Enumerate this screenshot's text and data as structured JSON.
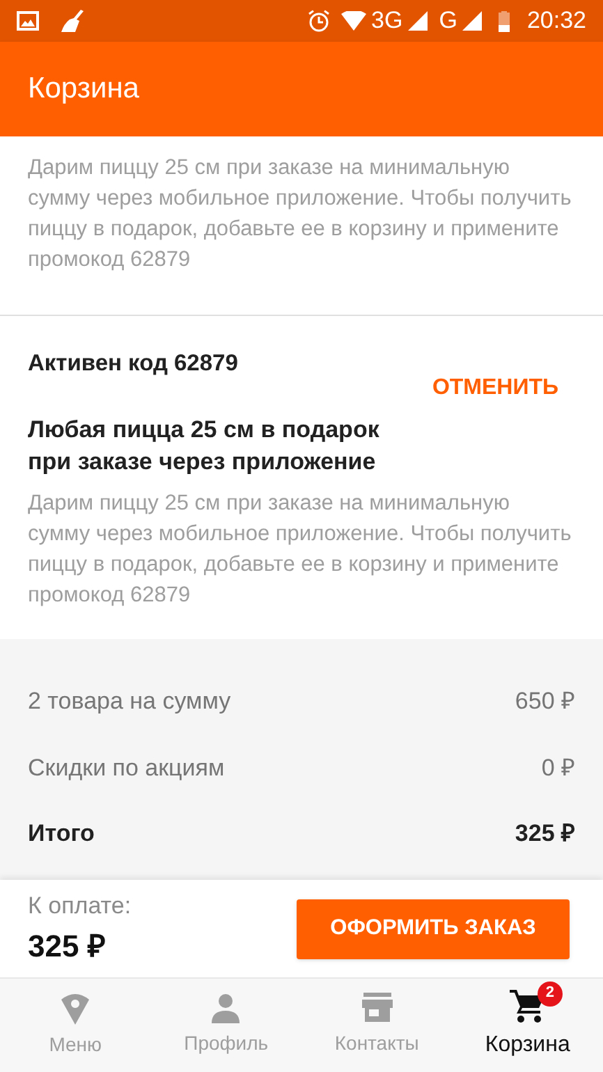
{
  "status_bar": {
    "network_1": "3G",
    "network_2": "G",
    "time": "20:32"
  },
  "app_bar": {
    "title": "Корзина"
  },
  "promo_description": "Дарим пиццу 25 см при заказе на минимальную сумму через мобильное приложение. Чтобы получить пиццу в подарок, добавьте ее в корзину и примените промокод 62879",
  "active_promo": {
    "code_label": "Активен код 62879",
    "cancel_button": "ОТМЕНИТЬ",
    "title": "Любая пицца 25 см в подарок при заказе через приложение",
    "description": "Дарим пиццу 25 см при заказе на минимальную сумму через мобильное приложение. Чтобы получить пиццу в подарок, добавьте ее в корзину и примените промокод 62879"
  },
  "summary": [
    {
      "label": "2 товара на сумму",
      "value": "650 ₽",
      "kind": "normal"
    },
    {
      "label": "Скидки по акциям",
      "value": "0 ₽",
      "kind": "normal"
    },
    {
      "label": "Итого",
      "value": "325 ₽",
      "kind": "total"
    }
  ],
  "checkout": {
    "label": "К оплате:",
    "amount": "325 ₽",
    "button": "ОФОРМИТЬ ЗАКАЗ"
  },
  "bottom_nav": [
    {
      "label": "Меню",
      "kind": "menu",
      "selected": false
    },
    {
      "label": "Профиль",
      "kind": "profile",
      "selected": false
    },
    {
      "label": "Контакты",
      "kind": "contacts",
      "selected": false
    },
    {
      "label": "Корзина",
      "kind": "cart",
      "selected": true,
      "badge": "2"
    }
  ]
}
